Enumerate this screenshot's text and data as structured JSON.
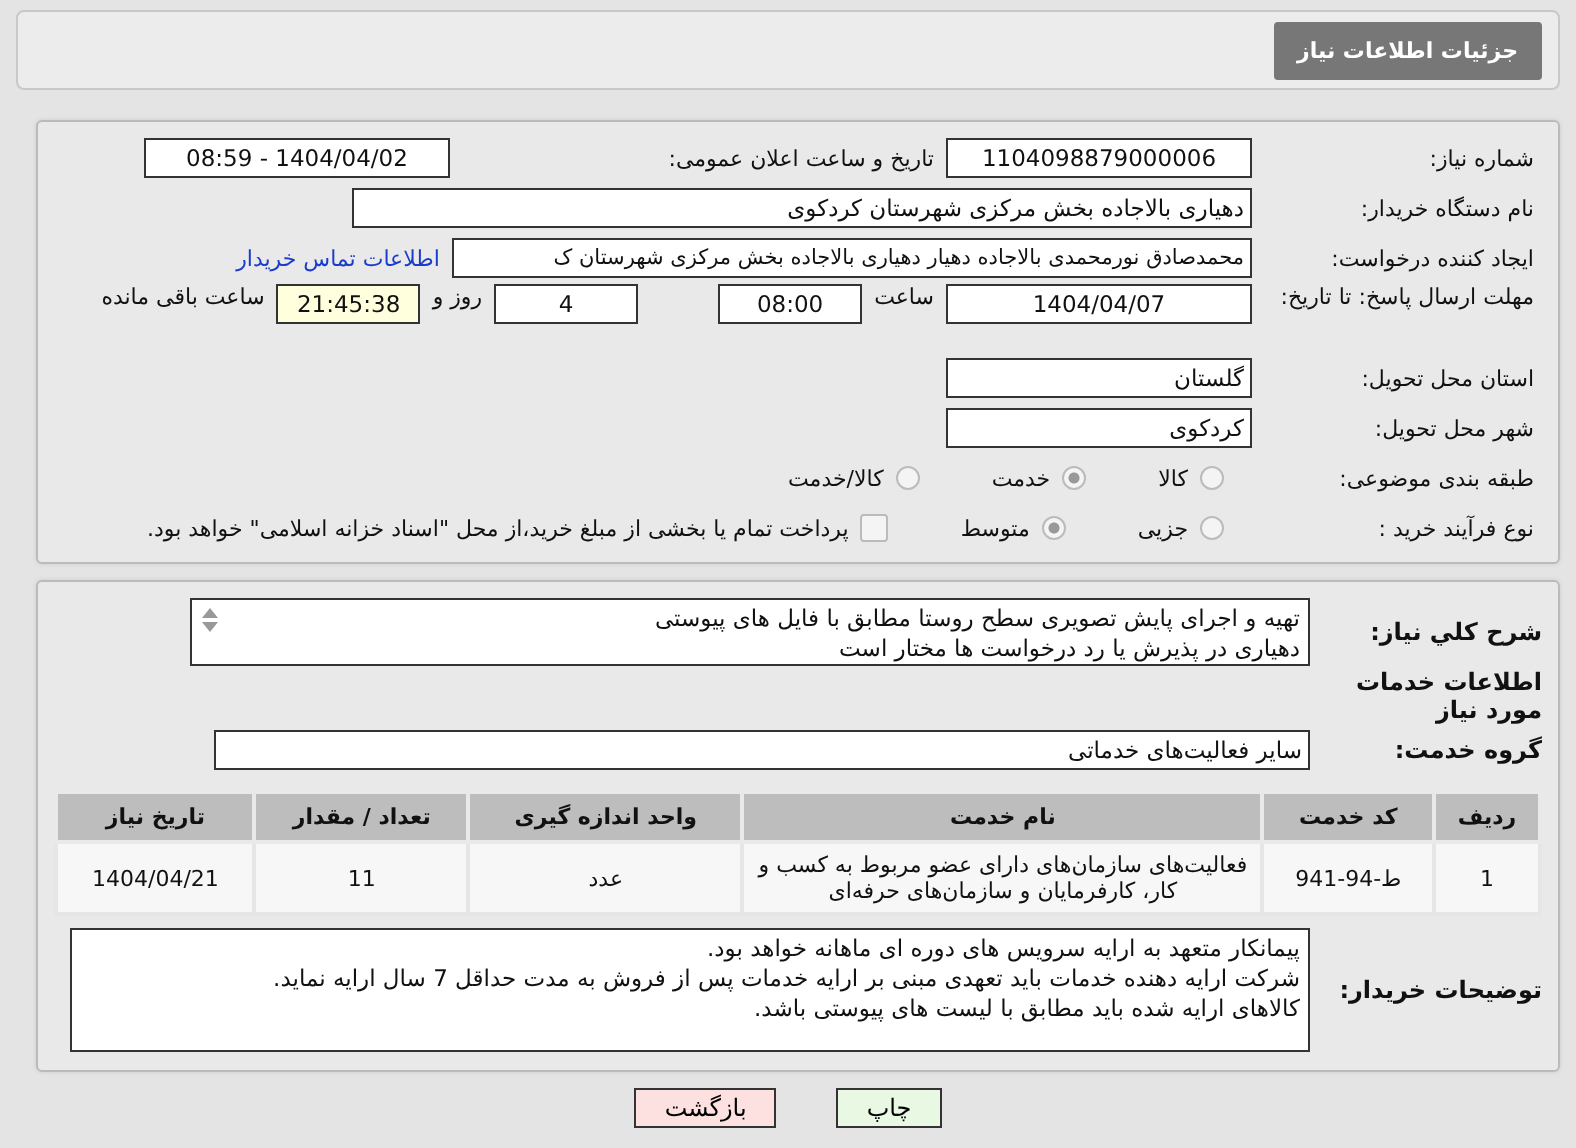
{
  "header": {
    "title": "جزئیات اطلاعات نیاز"
  },
  "need_number": {
    "label": "شماره نیاز:",
    "value": "1104098879000006"
  },
  "announce": {
    "label": "تاریخ و ساعت اعلان عمومی:",
    "value": "1404/04/02 - 08:59"
  },
  "buyer_org": {
    "label": "نام دستگاه خریدار:",
    "value": "دهیاری بالاجاده بخش مرکزی شهرستان کردکوی"
  },
  "creator": {
    "label": "ایجاد کننده درخواست:",
    "value": "محمدصادق نورمحمدی بالاجاده دهیار دهیاری بالاجاده بخش مرکزی شهرستان ک",
    "link": "اطلاعات تماس خریدار"
  },
  "deadline": {
    "label": "مهلت ارسال پاسخ: تا تاریخ:",
    "date": "1404/04/07",
    "time_label": "ساعت",
    "time": "08:00",
    "days": "4",
    "days_label": "روز و",
    "remaining": "21:45:38",
    "remaining_label": "ساعت باقی مانده"
  },
  "province": {
    "label": "استان محل تحویل:",
    "value": "گلستان"
  },
  "city": {
    "label": "شهر محل تحویل:",
    "value": "کردکوی"
  },
  "category": {
    "label": "طبقه بندی موضوعی:",
    "options": [
      {
        "label": "کالا",
        "selected": false
      },
      {
        "label": "خدمت",
        "selected": true
      },
      {
        "label": "کالا/خدمت",
        "selected": false
      }
    ]
  },
  "process": {
    "label": "نوع فرآیند خرید :",
    "options": [
      {
        "label": "جزیی",
        "selected": false
      },
      {
        "label": "متوسط",
        "selected": true
      }
    ],
    "payment": {
      "checked": false,
      "label": "پرداخت تمام یا بخشی از مبلغ خرید،از محل \"اسناد خزانه اسلامی\" خواهد بود."
    }
  },
  "description": {
    "label": "شرح کلي نیاز:",
    "lines": [
      "تهیه و اجرای پایش تصویری سطح روستا مطابق با فایل های پیوستی",
      "دهیاری در پذیرش یا رد درخواست ها مختار است"
    ]
  },
  "services": {
    "title": "اطلاعات خدمات مورد نیاز",
    "group_label": "گروه خدمت:",
    "group_value": "سایر فعالیت‌های خدماتی",
    "columns": [
      "ردیف",
      "کد خدمت",
      "نام خدمت",
      "واحد اندازه گیری",
      "تعداد / مقدار",
      "تاریخ نیاز"
    ],
    "rows": [
      [
        "1",
        "ط-94-941",
        "فعالیت‌های سازمان‌های دارای عضو مربوط به کسب و کار، کارفرمایان و سازمان‌های حرفه‌ای",
        "عدد",
        "11",
        "1404/04/21"
      ]
    ]
  },
  "buyer_notes": {
    "label": "توضیحات خریدار:",
    "lines": [
      "پیمانکار متعهد به ارایه سرویس های دوره ای ماهانه خواهد بود.",
      "شرکت ارایه دهنده خدمات باید تعهدی مبنی بر ارایه خدمات پس از فروش به مدت حداقل 7 سال ارایه نماید.",
      "کالاهای ارایه شده باید مطابق با لیست های پیوستی باشد."
    ]
  },
  "buttons": [
    {
      "label": "چاپ",
      "kind": "print"
    },
    {
      "label": "بازگشت",
      "kind": "back"
    }
  ]
}
